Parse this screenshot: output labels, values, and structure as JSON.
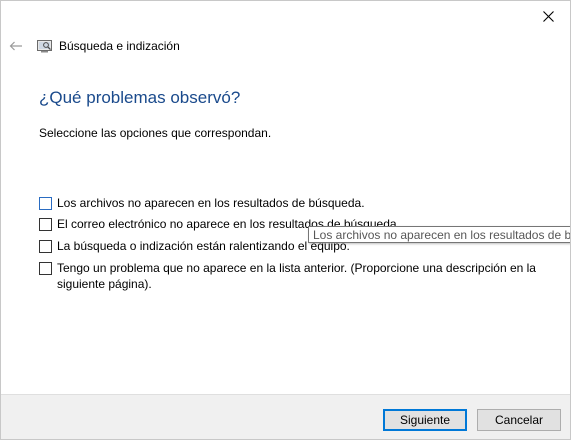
{
  "window": {
    "title": "Búsqueda e indización",
    "close_icon": "close-icon",
    "back_icon": "arrow-left-icon",
    "app_icon": "search-indexing-icon"
  },
  "main": {
    "title": "¿Qué problemas observó?",
    "instruction": "Seleccione las opciones que correspondan."
  },
  "options": [
    {
      "label": "Los archivos no aparecen en los resultados de búsqueda.",
      "checked": false
    },
    {
      "label": "El correo electrónico no aparece en los resultados de búsqueda.",
      "checked": false
    },
    {
      "label": "La búsqueda o indización están ralentizando el equipo.",
      "checked": false
    },
    {
      "label": "Tengo un problema que no aparece en la lista anterior. (Proporcione una descripción en la siguiente página).",
      "checked": false
    }
  ],
  "tooltip": {
    "text": "Los archivos no aparecen en los resultados de búsqueda."
  },
  "footer": {
    "next_label": "Siguiente",
    "cancel_label": "Cancelar"
  },
  "colors": {
    "title": "#1a4a8c",
    "primary_border": "#0078d7"
  }
}
